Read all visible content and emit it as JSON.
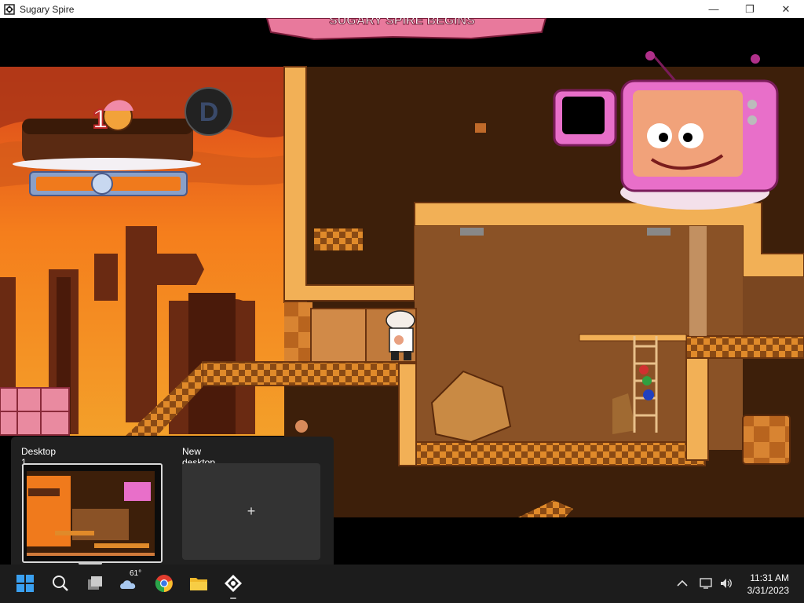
{
  "window": {
    "title": "Sugary Spire",
    "minimize": "—",
    "maximize": "❐",
    "close": "✕"
  },
  "game": {
    "banner_text": "SUGARY SPIRE BEGINS",
    "rank_letter": "D",
    "score_digits": "1",
    "colors": {
      "sky": "#f07a1c",
      "wall": "#3d1f0a",
      "floor_checker_a": "#e08a2a",
      "floor_checker_b": "#8a4a14",
      "tv_frame": "#e86fc9"
    }
  },
  "taskview": {
    "desktops": [
      {
        "label": "Desktop 1"
      },
      {
        "label": "New desktop",
        "add_symbol": "+"
      }
    ]
  },
  "taskbar": {
    "apps": [
      "start-icon",
      "search-icon",
      "task-view-icon",
      "weather-icon",
      "chrome-icon",
      "file-explorer-icon",
      "sugary-spire-icon"
    ],
    "weather_temp": "61°",
    "tray": [
      "chevron-up-icon",
      "network-icon",
      "volume-icon"
    ],
    "time": "11:31 AM",
    "date": "3/31/2023"
  }
}
